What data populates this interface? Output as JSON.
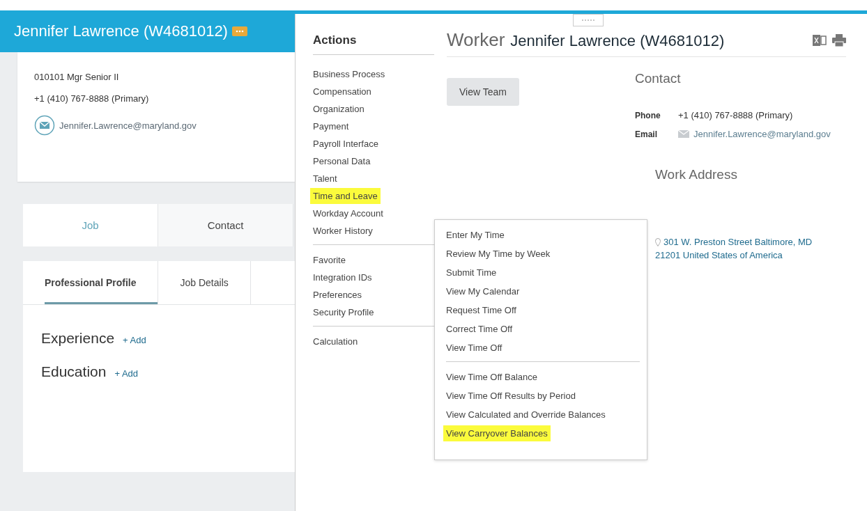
{
  "profile": {
    "name": "Jennifer Lawrence (W4681012)",
    "position": "010101 Mgr Senior II",
    "phone": "+1 (410) 767-8888 (Primary)",
    "email": "Jennifer.Lawrence@maryland.gov"
  },
  "tabs": [
    {
      "label": "Job",
      "selected": true
    },
    {
      "label": "Contact",
      "selected": false
    }
  ],
  "subtabs": [
    {
      "label": "Professional Profile",
      "selected": true
    },
    {
      "label": "Job Details",
      "selected": false
    }
  ],
  "sections": [
    {
      "title": "Experience",
      "action": "+ Add"
    },
    {
      "title": "Education",
      "action": "+ Add"
    }
  ],
  "actions": {
    "title": "Actions",
    "groups": [
      [
        {
          "label": "Business Process",
          "highlighted": false
        },
        {
          "label": "Compensation",
          "highlighted": false
        },
        {
          "label": "Organization",
          "highlighted": false
        },
        {
          "label": "Payment",
          "highlighted": false
        },
        {
          "label": "Payroll Interface",
          "highlighted": false
        },
        {
          "label": "Personal Data",
          "highlighted": false
        },
        {
          "label": "Talent",
          "highlighted": false
        },
        {
          "label": "Time and Leave",
          "highlighted": true
        },
        {
          "label": "Workday Account",
          "highlighted": false
        },
        {
          "label": "Worker History",
          "highlighted": false
        }
      ],
      [
        {
          "label": "Favorite",
          "highlighted": false
        },
        {
          "label": "Integration IDs",
          "highlighted": false
        },
        {
          "label": "Preferences",
          "highlighted": false
        },
        {
          "label": "Security Profile",
          "highlighted": false
        }
      ],
      [
        {
          "label": "Calculation",
          "highlighted": false
        }
      ]
    ]
  },
  "submenu": {
    "groups": [
      [
        {
          "label": "Enter My Time",
          "highlighted": false
        },
        {
          "label": "Review My Time by Week",
          "highlighted": false
        },
        {
          "label": "Submit Time",
          "highlighted": false
        },
        {
          "label": "View My Calendar",
          "highlighted": false
        },
        {
          "label": "Request Time Off",
          "highlighted": false
        },
        {
          "label": "Correct Time Off",
          "highlighted": false
        },
        {
          "label": "View Time Off",
          "highlighted": false
        }
      ],
      [
        {
          "label": "View Time Off Balance",
          "highlighted": false
        },
        {
          "label": "View Time Off Results by Period",
          "highlighted": false
        },
        {
          "label": "View Calculated and Override Balances",
          "highlighted": false
        },
        {
          "label": "View Carryover Balances",
          "highlighted": true
        }
      ]
    ]
  },
  "worker": {
    "prefix": "Worker",
    "name": "Jennifer Lawrence (W4681012)",
    "button": "View Team",
    "contact": {
      "title": "Contact",
      "fields": [
        {
          "kind": "phone",
          "label": "Phone",
          "value": "+1 (410) 767-8888 (Primary)"
        },
        {
          "kind": "email",
          "label": "Email",
          "value": "Jennifer.Lawrence@maryland.gov"
        }
      ]
    },
    "address": {
      "title": "Work Address",
      "lines": [
        "301 W. Preston Street Baltimore, MD",
        "21201 United States of America"
      ]
    }
  }
}
